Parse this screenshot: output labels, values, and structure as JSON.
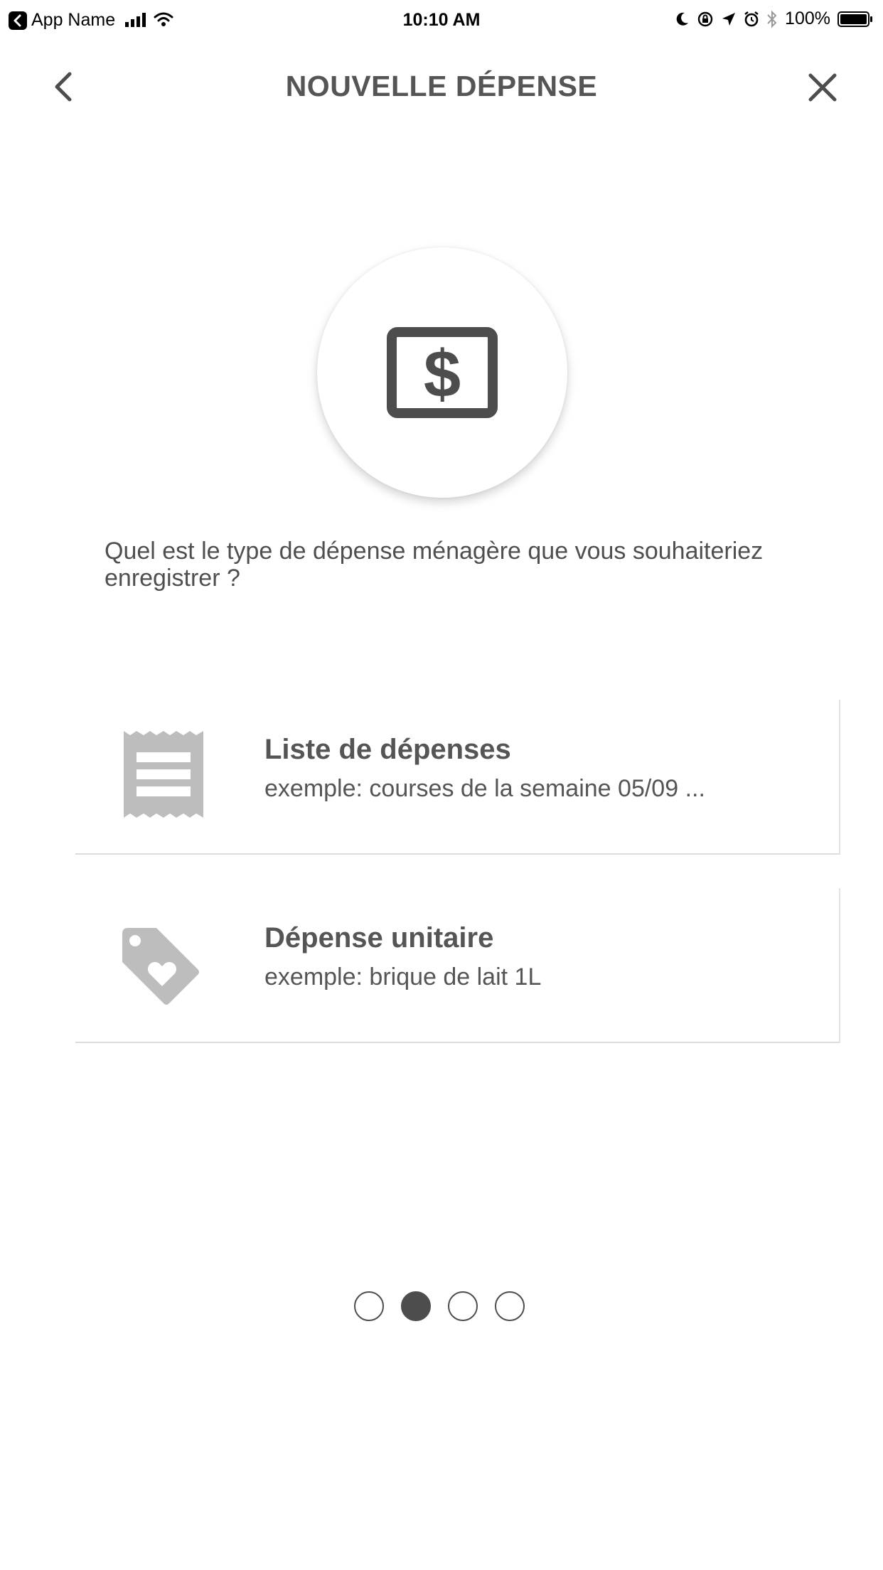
{
  "status_bar": {
    "app_name": "App Name",
    "time": "10:10 AM",
    "battery_percent": "100%"
  },
  "nav": {
    "title": "NOUVELLE DÉPENSE",
    "back_icon": "chevron-left-icon",
    "close_icon": "close-icon"
  },
  "hero": {
    "icon": "dollar-bill-icon"
  },
  "question": "Quel est le type de dépense ménagère que vous souhaiteriez enregistrer ?",
  "options": [
    {
      "icon": "receipt-icon",
      "title": "Liste de dépenses",
      "example": "exemple: courses de la semaine 05/09 ..."
    },
    {
      "icon": "tag-heart-icon",
      "title": "Dépense unitaire",
      "example": "exemple: brique de lait 1L"
    }
  ],
  "pager": {
    "total": 4,
    "active_index": 1
  },
  "colors": {
    "text": "#4f4f4f",
    "icon_dark": "#4d4d4d",
    "icon_light": "#bdbdbd",
    "divider": "#dcdcdc"
  }
}
